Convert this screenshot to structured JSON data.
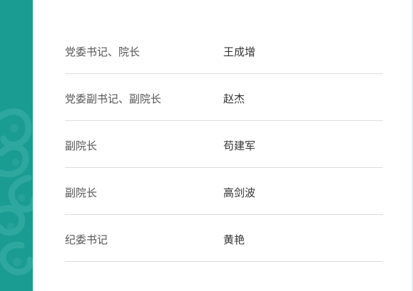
{
  "colors": {
    "side_band": "#1a9c93",
    "divider": "#dcdcdc",
    "role_text": "#555555",
    "name_text": "#333333"
  },
  "leaders": [
    {
      "role": "党委书记、院长",
      "name": "王成增"
    },
    {
      "role": "党委副书记、副院长",
      "name": "赵杰"
    },
    {
      "role": "副院长",
      "name": "苟建军"
    },
    {
      "role": "副院长",
      "name": "高剑波"
    },
    {
      "role": "纪委书记",
      "name": "黄艳"
    }
  ]
}
